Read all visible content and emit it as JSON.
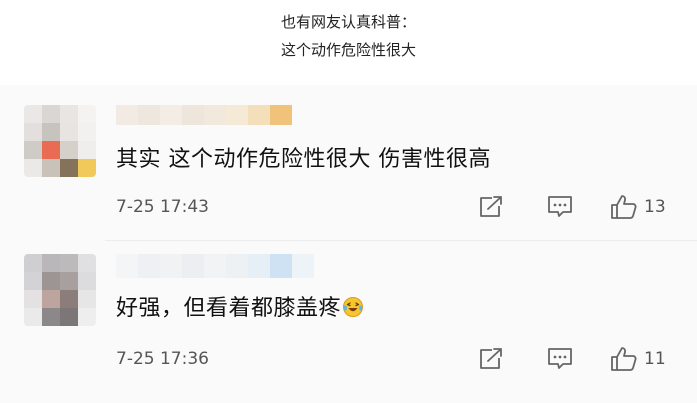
{
  "caption": {
    "line1": "也有网友认真科普：",
    "line2": "这个动作危险性很大"
  },
  "comments": [
    {
      "text": "其实 这个动作危险性很大 伤害性很高",
      "timestamp": "7-25 17:43",
      "likes": "13",
      "avatar": "pixelated",
      "username": "pixelated"
    },
    {
      "text": "好强，但看着都膝盖疼",
      "emoji": "laughing-crying-face",
      "timestamp": "7-25 17:36",
      "likes": "11",
      "avatar": "pixelated",
      "username": "pixelated"
    }
  ],
  "icons": {
    "share": "share-icon",
    "comment": "comment-icon",
    "like": "thumbs-up-icon"
  },
  "colors": {
    "page_bg": "#ffffff",
    "panel_bg": "#fafafa",
    "text": "#111111",
    "meta": "#555555"
  }
}
